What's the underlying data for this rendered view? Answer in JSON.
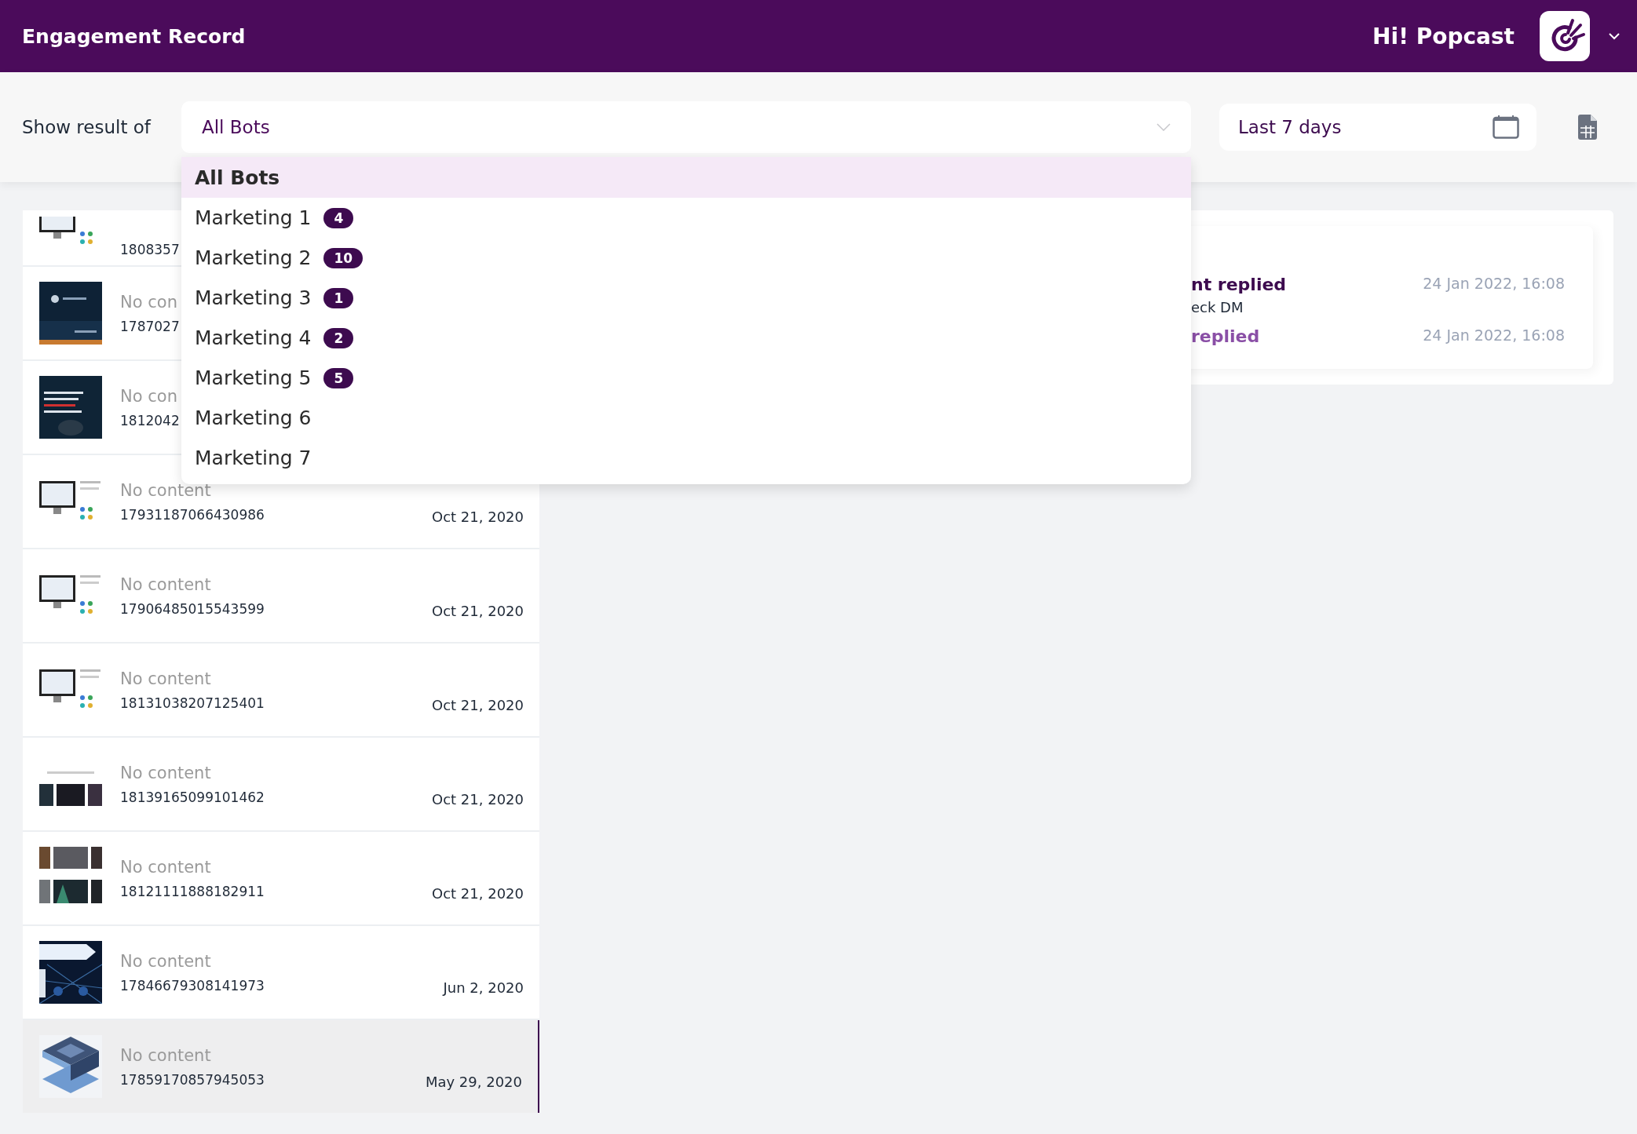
{
  "header": {
    "title": "Engagement Record",
    "greeting": "Hi! Popcast"
  },
  "filter": {
    "label": "Show result of",
    "bot_select": {
      "value": "All Bots",
      "expanded": true
    },
    "date_range": {
      "value": "Last 7 days"
    }
  },
  "bot_options": [
    {
      "label": "All Bots",
      "selected": true
    },
    {
      "label": "Marketing 1",
      "count": "4",
      "selected": false
    },
    {
      "label": "Marketing 2",
      "count": "10",
      "selected": false
    },
    {
      "label": "Marketing 3",
      "count": "1",
      "selected": false
    },
    {
      "label": "Marketing 4",
      "count": "2",
      "selected": false
    },
    {
      "label": "Marketing 5",
      "count": "5",
      "selected": false
    },
    {
      "label": "Marketing 6",
      "selected": false
    },
    {
      "label": "Marketing 7",
      "selected": false
    }
  ],
  "posts": [
    {
      "id": "1808357",
      "selected": false
    },
    {
      "title": "No con",
      "id": "1787027",
      "selected": false
    },
    {
      "title": "No con",
      "id": "1812042",
      "selected": false
    },
    {
      "title": "No content",
      "id": "17931187066430986",
      "date": "Oct 21, 2020",
      "selected": false
    },
    {
      "title": "No content",
      "id": "17906485015543599",
      "date": "Oct 21, 2020",
      "selected": false
    },
    {
      "title": "No content",
      "id": "18131038207125401",
      "date": "Oct 21, 2020",
      "selected": false
    },
    {
      "title": "No content",
      "id": "18139165099101462",
      "date": "Oct 21, 2020",
      "selected": false
    },
    {
      "title": "No content",
      "id": "18121111888182911",
      "date": "Oct 21, 2020",
      "selected": false
    },
    {
      "title": "No content",
      "id": "17846679308141973",
      "date": "Jun 2, 2020",
      "selected": false
    },
    {
      "title": "No content",
      "id": "17859170857945053",
      "date": "May 29, 2020",
      "selected": true
    }
  ],
  "activity": [
    {
      "kind": "sent",
      "title": "nt replied",
      "subtitle": "eck DM",
      "time": "24 Jan 2022, 16:08"
    },
    {
      "kind": "received",
      "title": "replied",
      "time": "24 Jan 2022, 16:08"
    }
  ]
}
